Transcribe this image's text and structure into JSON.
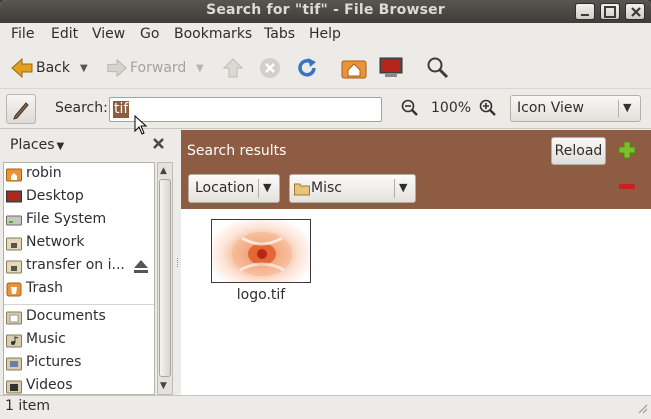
{
  "window": {
    "title": "Search for \"tif\" - File Browser"
  },
  "menubar": {
    "items": [
      {
        "label": "File"
      },
      {
        "label": "Edit"
      },
      {
        "label": "View"
      },
      {
        "label": "Go"
      },
      {
        "label": "Bookmarks"
      },
      {
        "label": "Tabs"
      },
      {
        "label": "Help"
      }
    ]
  },
  "toolbar": {
    "back_label": "Back",
    "forward_label": "Forward"
  },
  "searchbar": {
    "label": "Search:",
    "query": "tif",
    "zoom": "100%",
    "view_mode": "Icon View"
  },
  "sidebar": {
    "header": "Places",
    "places": [
      {
        "label": "robin",
        "icon": "home-folder-icon"
      },
      {
        "label": "Desktop",
        "icon": "desktop-icon"
      },
      {
        "label": "File System",
        "icon": "drive-icon"
      },
      {
        "label": "Network",
        "icon": "network-icon"
      },
      {
        "label": "transfer on i...",
        "icon": "network-folder-icon"
      },
      {
        "label": "Trash",
        "icon": "trash-icon"
      }
    ],
    "bookmarks": [
      {
        "label": "Documents",
        "icon": "documents-folder-icon"
      },
      {
        "label": "Music",
        "icon": "music-folder-icon"
      },
      {
        "label": "Pictures",
        "icon": "pictures-folder-icon"
      },
      {
        "label": "Videos",
        "icon": "videos-folder-icon"
      }
    ]
  },
  "results": {
    "title": "Search results",
    "reload_label": "Reload",
    "criteria_type": "Location",
    "criteria_value": "Misc",
    "files": [
      {
        "name": "logo.tif"
      }
    ]
  },
  "status": {
    "text": "1 item"
  },
  "colors": {
    "results_bar": "#8e5c42",
    "selection": "#8b5d41",
    "titlebar": "#3e3d39"
  }
}
